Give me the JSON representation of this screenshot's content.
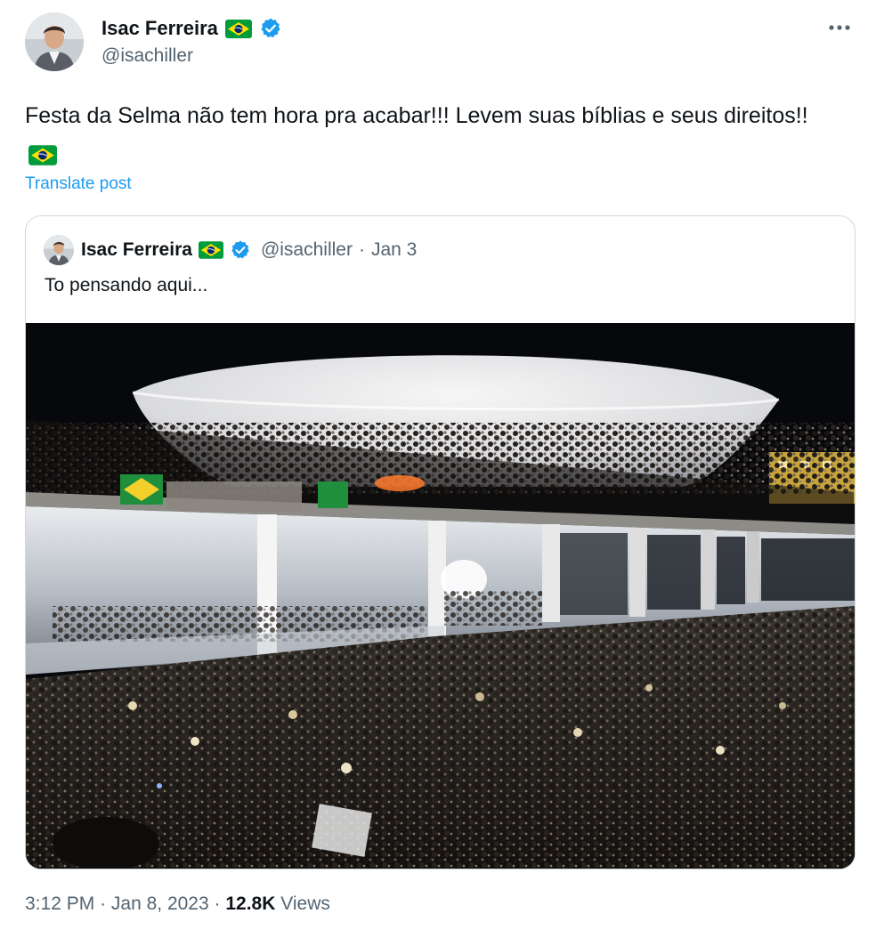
{
  "author": {
    "name": "Isac Ferreira",
    "handle": "@isachiller",
    "flag_icon": "brazil-flag-icon",
    "verified_icon": "verified-badge-icon"
  },
  "post": {
    "text": "Festa da Selma não tem hora pra acabar!!! Levem suas bíblias e seus direitos!!",
    "translate_label": "Translate post"
  },
  "quoted": {
    "name": "Isac Ferreira",
    "handle": "@isachiller",
    "separator": "·",
    "date": "Jan 3",
    "text": "To pensando aqui..."
  },
  "meta": {
    "time": "3:12 PM",
    "sep1": "·",
    "date": "Jan 8, 2023",
    "sep2": "·",
    "views_count": "12.8K",
    "views_label": "Views"
  },
  "more_icon": "more-horizontal-icon",
  "colors": {
    "link": "#1d9bf0",
    "secondary_text": "#536471",
    "verified": "#1d9bf0",
    "border": "#cfd9de"
  }
}
